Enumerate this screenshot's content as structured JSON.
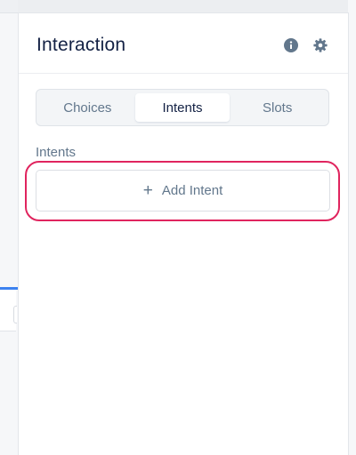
{
  "panel": {
    "title": "Interaction",
    "icons": {
      "info": "info-icon",
      "settings": "gear-icon"
    }
  },
  "tabs": [
    {
      "label": "Choices",
      "active": false
    },
    {
      "label": "Intents",
      "active": true
    },
    {
      "label": "Slots",
      "active": false
    }
  ],
  "intents_section": {
    "label": "Intents",
    "add_button": {
      "icon": "plus-icon",
      "label": "Add Intent"
    }
  },
  "colors": {
    "title_text": "#132144",
    "muted_text": "#62778c",
    "highlight_ring": "#e0245e",
    "canvas_accent": "#3d82f0"
  }
}
